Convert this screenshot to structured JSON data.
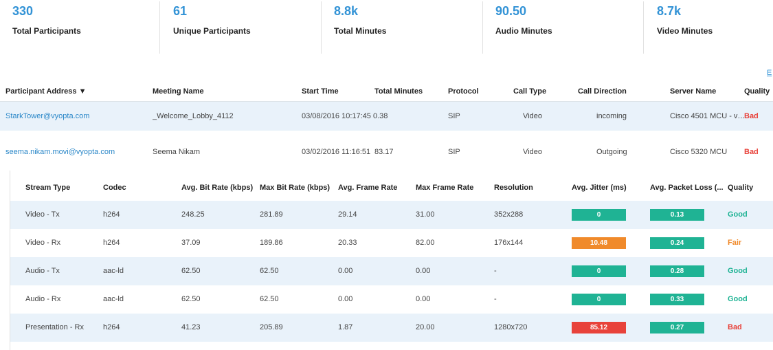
{
  "stats": [
    {
      "value": "330",
      "label": "Total Participants"
    },
    {
      "value": "61",
      "label": "Unique Participants"
    },
    {
      "value": "8.8k",
      "label": "Total Minutes"
    },
    {
      "value": "90.50",
      "label": "Audio Minutes"
    },
    {
      "value": "8.7k",
      "label": "Video Minutes"
    }
  ],
  "edge_link": "E",
  "participants": {
    "headers": {
      "address": "Participant Address ▼",
      "meeting": "Meeting Name",
      "start": "Start Time",
      "minutes": "Total Minutes",
      "protocol": "Protocol",
      "call_type": "Call Type",
      "direction": "Call Direction",
      "server": "Server Name",
      "quality": "Quality"
    },
    "rows": [
      {
        "address": "StarkTower@vyopta.com",
        "meeting": "_Welcome_Lobby_4112",
        "start": "03/08/2016 10:17:45",
        "minutes": "0.38",
        "protocol": "SIP",
        "call_type": "Video",
        "direction": "incoming",
        "server": "Cisco 4501 MCU - v…",
        "quality": "Bad"
      },
      {
        "address": "seema.nikam.movi@vyopta.com",
        "meeting": "Seema Nikam",
        "start": "03/02/2016 11:16:51",
        "minutes": "83.17",
        "protocol": "SIP",
        "call_type": "Video",
        "direction": "Outgoing",
        "server": "Cisco 5320 MCU",
        "quality": "Bad"
      }
    ]
  },
  "streams": {
    "headers": {
      "type": "Stream Type",
      "codec": "Codec",
      "avg_bitrate": "Avg. Bit Rate (kbps)",
      "max_bitrate": "Max Bit Rate (kbps)",
      "avg_frame": "Avg. Frame Rate",
      "max_frame": "Max Frame Rate",
      "resolution": "Resolution",
      "jitter": "Avg. Jitter (ms)",
      "loss": "Avg. Packet Loss (...",
      "quality": "Quality"
    },
    "rows": [
      {
        "type": "Video - Tx",
        "codec": "h264",
        "avg_bitrate": "248.25",
        "max_bitrate": "281.89",
        "avg_frame": "29.14",
        "max_frame": "31.00",
        "resolution": "352x288",
        "jitter": "0",
        "loss": "0.13",
        "quality": "Good"
      },
      {
        "type": "Video - Rx",
        "codec": "h264",
        "avg_bitrate": "37.09",
        "max_bitrate": "189.86",
        "avg_frame": "20.33",
        "max_frame": "82.00",
        "resolution": "176x144",
        "jitter": "10.48",
        "loss": "0.24",
        "quality": "Fair"
      },
      {
        "type": "Audio - Tx",
        "codec": "aac-ld",
        "avg_bitrate": "62.50",
        "max_bitrate": "62.50",
        "avg_frame": "0.00",
        "max_frame": "0.00",
        "resolution": "-",
        "jitter": "0",
        "loss": "0.28",
        "quality": "Good"
      },
      {
        "type": "Audio - Rx",
        "codec": "aac-ld",
        "avg_bitrate": "62.50",
        "max_bitrate": "62.50",
        "avg_frame": "0.00",
        "max_frame": "0.00",
        "resolution": "-",
        "jitter": "0",
        "loss": "0.33",
        "quality": "Good"
      },
      {
        "type": "Presentation - Rx",
        "codec": "h264",
        "avg_bitrate": "41.23",
        "max_bitrate": "205.89",
        "avg_frame": "1.87",
        "max_frame": "20.00",
        "resolution": "1280x720",
        "jitter": "85.12",
        "loss": "0.27",
        "quality": "Bad"
      }
    ]
  },
  "colors": {
    "accent": "#3393d6",
    "good": "#1fb394",
    "fair": "#f08a2b",
    "bad": "#e8423a",
    "row_highlight": "#e9f2fa"
  }
}
